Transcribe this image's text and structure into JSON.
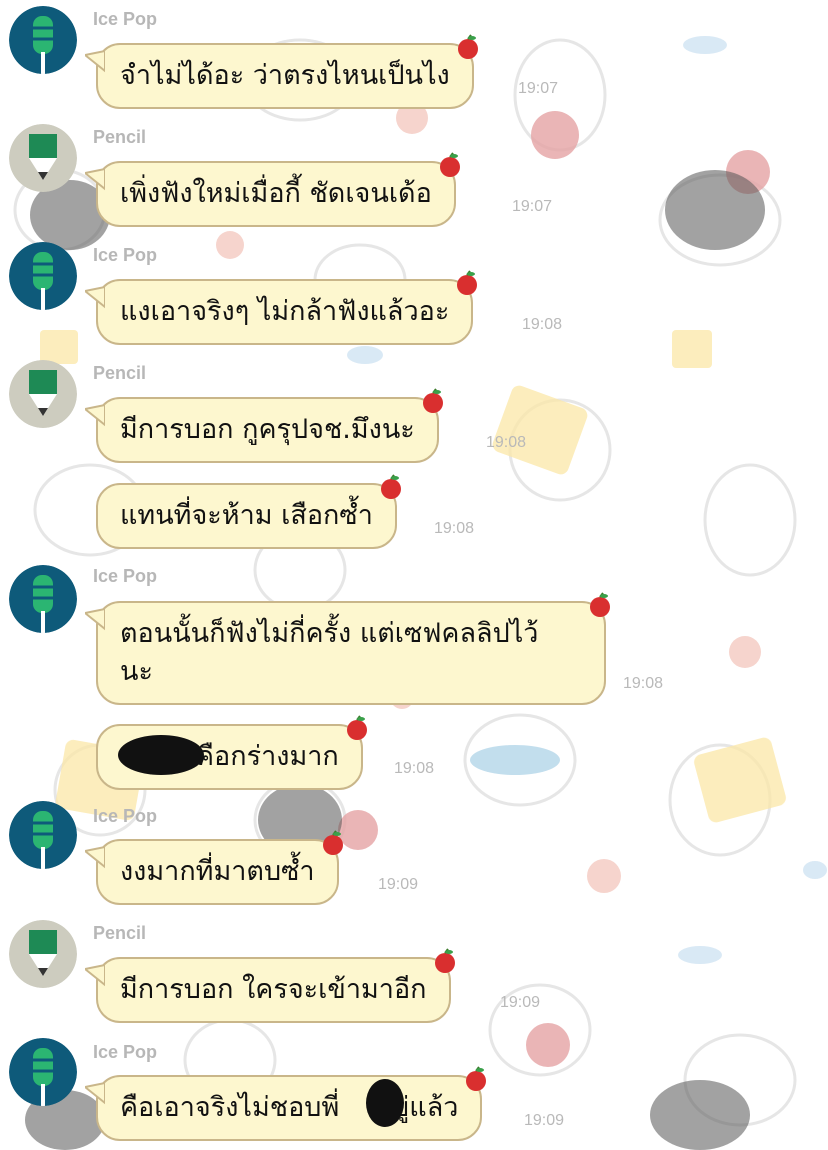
{
  "messages": [
    {
      "sender": "Ice Pop",
      "avatar": "ice-pop",
      "text": "จำไม่ได้อะ ว่าตรงไหนเป็นไง",
      "time": "19:07"
    },
    {
      "sender": "Pencil",
      "avatar": "pencil",
      "text": "เพิ่งฟังใหม่เมื่อกี้ ชัดเจนเด้อ",
      "time": "19:07"
    },
    {
      "sender": "Ice Pop",
      "avatar": "ice-pop",
      "text": "แงเอาจริงๆ ไม่กล้าฟังแล้วอะ",
      "time": "19:08"
    },
    {
      "sender": "Pencil",
      "avatar": "pencil",
      "text": "มีการบอก กูครุปจช.มึงนะ",
      "time": "19:08"
    },
    {
      "sender": "",
      "avatar": "",
      "text": "แทนที่จะห้าม เสือกซ้ำ",
      "time": "19:08"
    },
    {
      "sender": "Ice Pop",
      "avatar": "ice-pop",
      "text_line1": "ตอนนั้นก็ฟังไม่กี่ครั้ง แต่เซฟคลลิปไว้",
      "text_line2": "นะ",
      "time": "19:08"
    },
    {
      "sender": "",
      "avatar": "",
      "text": "คือกร่างมาก",
      "time": "19:08"
    },
    {
      "sender": "Ice Pop",
      "avatar": "ice-pop",
      "text": "งงมากที่มาตบซ้ำ",
      "time": "19:09"
    },
    {
      "sender": "Pencil",
      "avatar": "pencil",
      "text": "มีการบอก ใครจะเข้ามาอีก",
      "time": "19:09"
    },
    {
      "sender": "Ice Pop",
      "avatar": "ice-pop",
      "text_part1": "คือเอาจริงไม่ชอบพี่",
      "text_part2": "อยู่แล้ว",
      "time": "19:09"
    }
  ],
  "colors": {
    "bubble_fill": "#fdf7cf",
    "bubble_border": "#c9b68a",
    "ice_pop_avatar_bg": "#0e5a7a",
    "ice_pop_green": "#2bb572",
    "pencil_avatar_bg": "#cdccbf",
    "pencil_green": "#1e8a55",
    "timestamp": "#b9b9b9",
    "sender_name": "#b7b7b7"
  },
  "icons": {
    "bubble_decoration": "apple-icon",
    "redaction": "black-scribble"
  }
}
